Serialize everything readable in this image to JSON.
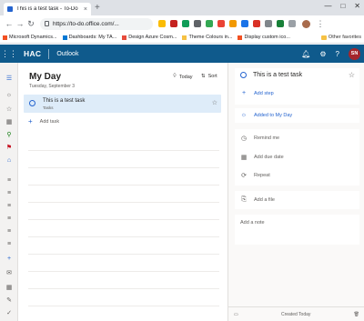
{
  "browser": {
    "tab_title": "This is a test task - To-Do",
    "tab_close": "×",
    "new_tab": "+",
    "url": "https://to-do.office.com/...",
    "window_controls": [
      "—",
      "□",
      "✕"
    ]
  },
  "bookmarks": {
    "items": [
      {
        "label": "Microsoft Dynamics...",
        "color": "#f25022"
      },
      {
        "label": "Dashboards: My TA...",
        "color": "#0078d4"
      },
      {
        "label": "Design Azure Cosm...",
        "color": "#e74c3c"
      },
      {
        "label": "Theme Colours in...",
        "color": "#f6c143"
      },
      {
        "label": "Display custom ico...",
        "color": "#f25022"
      }
    ],
    "other": "Other favorites"
  },
  "app": {
    "brand": "HAC",
    "section": "Outlook",
    "avatar_initials": "SN",
    "header_color": "#0f5a8c"
  },
  "list": {
    "title": "My Day",
    "date": "Tuesday, September 3",
    "today_label": "Today",
    "sort_label": "Sort",
    "tasks": [
      {
        "title": "This is a test task",
        "list": "Tasks"
      }
    ],
    "add_task_label": "Add task"
  },
  "detail": {
    "task_title": "This is a test task",
    "add_step": "Add step",
    "added_to_my_day": "Added to My Day",
    "remind_me": "Remind me",
    "add_due_date": "Add due date",
    "repeat": "Repeat",
    "add_file": "Add a file",
    "add_note": "Add a note",
    "footer": "Created Today"
  },
  "accent_color": "#2564cf"
}
